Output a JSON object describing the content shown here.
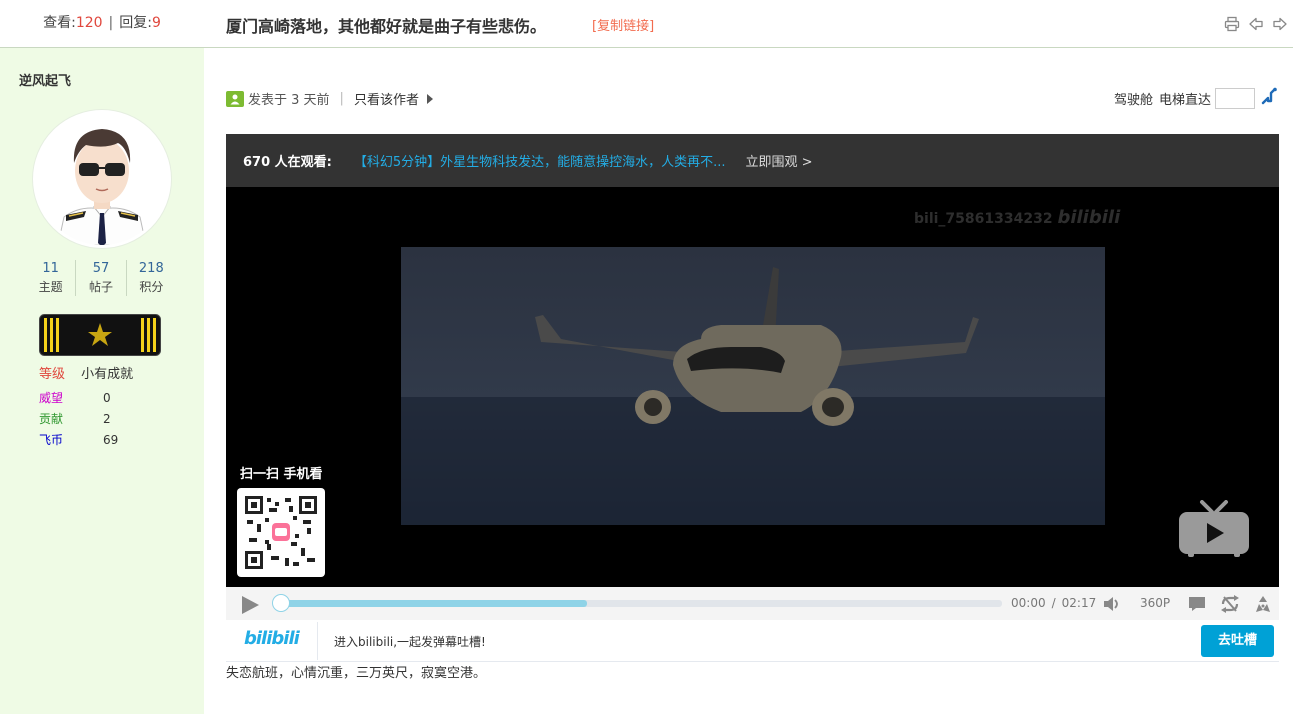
{
  "stats": {
    "views_label": "查看:",
    "views": "120",
    "replies_label": "回复:",
    "replies": "9",
    "separator": "|"
  },
  "thread": {
    "title": "厦门高崎落地，其他都好就是曲子有些悲伤。",
    "copy_link": "[复制链接]"
  },
  "toolbar_icons": [
    "print-icon",
    "prev-thread-icon",
    "next-thread-icon"
  ],
  "author": {
    "name": "逆风起飞",
    "stats": [
      {
        "value": "11",
        "label": "主题"
      },
      {
        "value": "57",
        "label": "帖子"
      },
      {
        "value": "218",
        "label": "积分"
      }
    ],
    "level_label": "等级",
    "level_value": "小有成就",
    "attributes": [
      {
        "label": "威望",
        "value": "0",
        "color": "#cc00cc"
      },
      {
        "label": "贡献",
        "value": "2",
        "color": "#339933"
      },
      {
        "label": "飞币",
        "value": "69",
        "color": "#0000cc"
      }
    ]
  },
  "post_meta": {
    "posted": "发表于 3 天前",
    "separator": "|",
    "only_author": "只看该作者"
  },
  "jump": {
    "label1": "驾驶舱",
    "label2": "电梯直达"
  },
  "player": {
    "live_count": "670 人在观看:",
    "live_link": "【科幻5分钟】外星生物科技发达，能随意操控海水，人类再不...",
    "live_go": "立即围观 >",
    "watermark": "bili_75861334232",
    "scan_label": "扫一扫 手机看",
    "current_time": "00:00",
    "time_separator": "/",
    "duration": "02:17",
    "quality": "360P",
    "progress_buffered": 0.43,
    "progress_played": 0.0
  },
  "danmaku": {
    "logo": "bilibili",
    "hint": "进入bilibili,一起发弹幕吐槽!",
    "send_label": "去吐槽"
  },
  "post_body": "失恋航班，心情沉重，三万英尺，寂寞空港。",
  "colors": {
    "sidebar_bg": "#effbe5",
    "accent_red": "#e0473d",
    "bili_blue": "#00a1d6",
    "link_orange": "#f26c4f"
  }
}
